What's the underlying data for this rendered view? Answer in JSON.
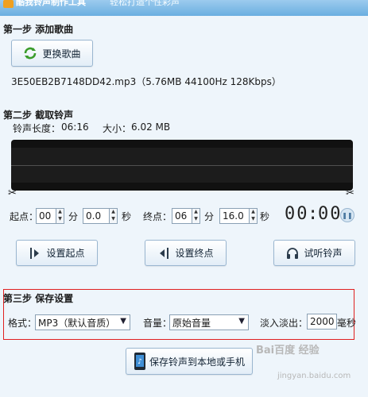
{
  "window": {
    "title": "酷我铃声制作工具",
    "subtitle": "轻松打造个性彩声"
  },
  "step1": {
    "heading": "第一步  添加歌曲",
    "change_song_label": "更换歌曲",
    "file_info": "3E50EB2B7148DD42.mp3（5.76MB 44100Hz  128Kbps）"
  },
  "step2": {
    "heading": "第二步  截取铃声",
    "duration_label": "铃声长度：",
    "duration_value": "06:16",
    "size_label": "大小：",
    "size_value": "6.02 MB",
    "start_label": "起点：",
    "start_min": "00",
    "min_unit": "分",
    "start_sec": "0.0",
    "sec_unit": "秒",
    "end_label": "终点：",
    "end_min": "06",
    "end_sec": "16.0",
    "timer_min": "00",
    "timer_sep": ":",
    "timer_sec": "00",
    "set_start_label": "设置起点",
    "set_end_label": "设置终点",
    "preview_label": "试听铃声"
  },
  "step3": {
    "heading": "第三步  保存设置",
    "format_label": "格式：",
    "format_value": "MP3（默认音质）",
    "volume_label": "音量：",
    "volume_value": "原始音量",
    "fade_label": "淡入淡出：",
    "fade_value": "2000",
    "fade_unit": "毫秒",
    "save_label": "保存铃声到本地或手机"
  },
  "watermark": {
    "brand": "Bai百度 经验",
    "url": "jingyan.baidu.com"
  },
  "colors": {
    "accent": "#6aaee0",
    "highlight_box": "#e02020",
    "waveform": "#111111"
  }
}
